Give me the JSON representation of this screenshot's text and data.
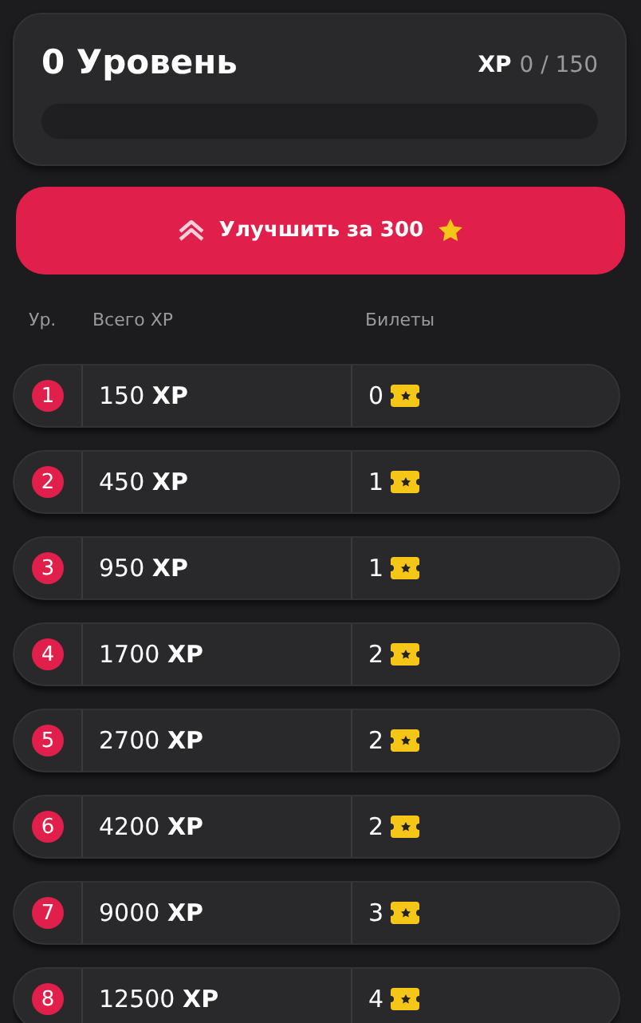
{
  "level_card": {
    "title": "0 Уровень",
    "xp_label": "XP",
    "xp_value": "0 / 150",
    "progress": {
      "level": 0
    }
  },
  "upgrade_button": {
    "label": "Улучшить за 300"
  },
  "table": {
    "columns": [
      "Ур.",
      "Всего XP",
      "Билеты"
    ],
    "rows": [
      {
        "level": "1",
        "xp": "150 **XP**",
        "tickets": "0"
      },
      {
        "level": "2",
        "xp": "450 **XP**",
        "tickets": "1"
      },
      {
        "level": "3",
        "xp": "950 **XP**",
        "tickets": "1"
      },
      {
        "level": "4",
        "xp": "1700 **XP**",
        "tickets": "2"
      },
      {
        "level": "5",
        "xp": "2700 **XP**",
        "tickets": "2"
      },
      {
        "level": "6",
        "xp": "4200 **XP**",
        "tickets": "2"
      },
      {
        "level": "7",
        "xp": "9000 **XP**",
        "tickets": "3"
      },
      {
        "level": "8",
        "xp": "12500 **XP**",
        "tickets": "4"
      }
    ]
  }
}
